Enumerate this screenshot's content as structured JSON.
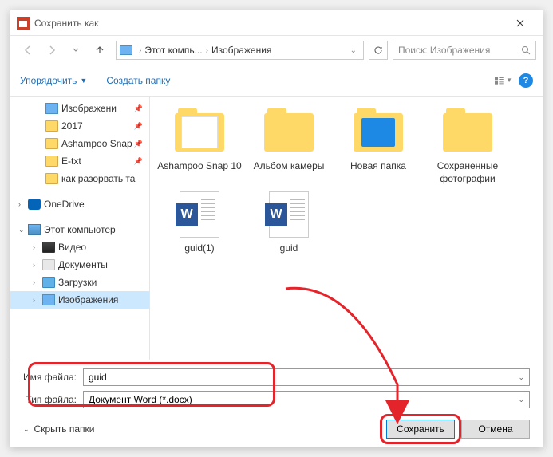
{
  "title": "Сохранить как",
  "breadcrumb": {
    "item1": "Этот компь...",
    "item2": "Изображения"
  },
  "search": {
    "placeholder": "Поиск: Изображения"
  },
  "toolbar": {
    "organize": "Упорядочить",
    "newfolder": "Создать папку"
  },
  "sidebar": {
    "items": [
      {
        "label": "Изображени",
        "icon": "img",
        "indent": 24,
        "pin": true,
        "arrow": "none"
      },
      {
        "label": "2017",
        "icon": "folder",
        "indent": 24,
        "pin": true,
        "arrow": "none"
      },
      {
        "label": "Ashampoo Snap",
        "icon": "folder",
        "indent": 24,
        "pin": true,
        "arrow": "none"
      },
      {
        "label": "E-txt",
        "icon": "folder",
        "indent": 24,
        "pin": true,
        "arrow": "none"
      },
      {
        "label": "как разорвать та",
        "icon": "folder",
        "indent": 24,
        "pin": false,
        "arrow": "none"
      },
      {
        "label": "",
        "spacer": true
      },
      {
        "label": "OneDrive",
        "icon": "onedrive",
        "indent": 2,
        "arrow": ">"
      },
      {
        "label": "",
        "spacer": true
      },
      {
        "label": "Этот компьютер",
        "icon": "pc",
        "indent": 2,
        "arrow": "v"
      },
      {
        "label": "Видео",
        "icon": "video",
        "indent": 20,
        "arrow": ">"
      },
      {
        "label": "Документы",
        "icon": "doc",
        "indent": 20,
        "arrow": ">"
      },
      {
        "label": "Загрузки",
        "icon": "download",
        "indent": 20,
        "arrow": ">"
      },
      {
        "label": "Изображения",
        "icon": "img",
        "indent": 20,
        "arrow": ">",
        "selected": true
      }
    ]
  },
  "content": {
    "items": [
      {
        "name": "Ashampoo Snap 10",
        "type": "folder-content"
      },
      {
        "name": "Альбом камеры",
        "type": "folder"
      },
      {
        "name": "Новая папка",
        "type": "folder-special"
      },
      {
        "name": "Сохраненные фотографии",
        "type": "folder"
      },
      {
        "name": "guid(1)",
        "type": "word"
      },
      {
        "name": "guid",
        "type": "word"
      }
    ]
  },
  "fields": {
    "filename_label": "Имя файла:",
    "filename_value": "guid",
    "filetype_label": "Тип файла:",
    "filetype_value": "Документ Word (*.docx)"
  },
  "buttons": {
    "hide_folders": "Скрыть папки",
    "save": "Сохранить",
    "cancel": "Отмена"
  }
}
